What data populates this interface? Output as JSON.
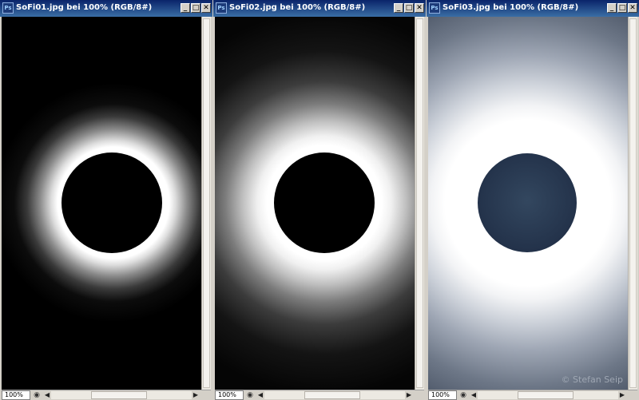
{
  "windows": [
    {
      "title": "SoFi01.jpg bei 100% (RGB/8#)",
      "zoom": "100%"
    },
    {
      "title": "SoFi02.jpg bei 100% (RGB/8#)",
      "zoom": "100%"
    },
    {
      "title": "SoFi03.jpg bei 100% (RGB/8#)",
      "zoom": "100%"
    }
  ],
  "controls": {
    "minimize": "_",
    "maximize": "□",
    "close": "✕"
  },
  "app_icon_label": "Ps",
  "watermark": "© Stefan Seip",
  "icons": [
    "photoshop-icon",
    "minimize-icon",
    "maximize-icon",
    "close-icon",
    "navigator-icon",
    "scroll-left-icon",
    "scroll-right-icon"
  ],
  "colors": {
    "title_start": "#0a246a",
    "title_end": "#3a6ea5",
    "chrome": "#d4d0c8"
  }
}
